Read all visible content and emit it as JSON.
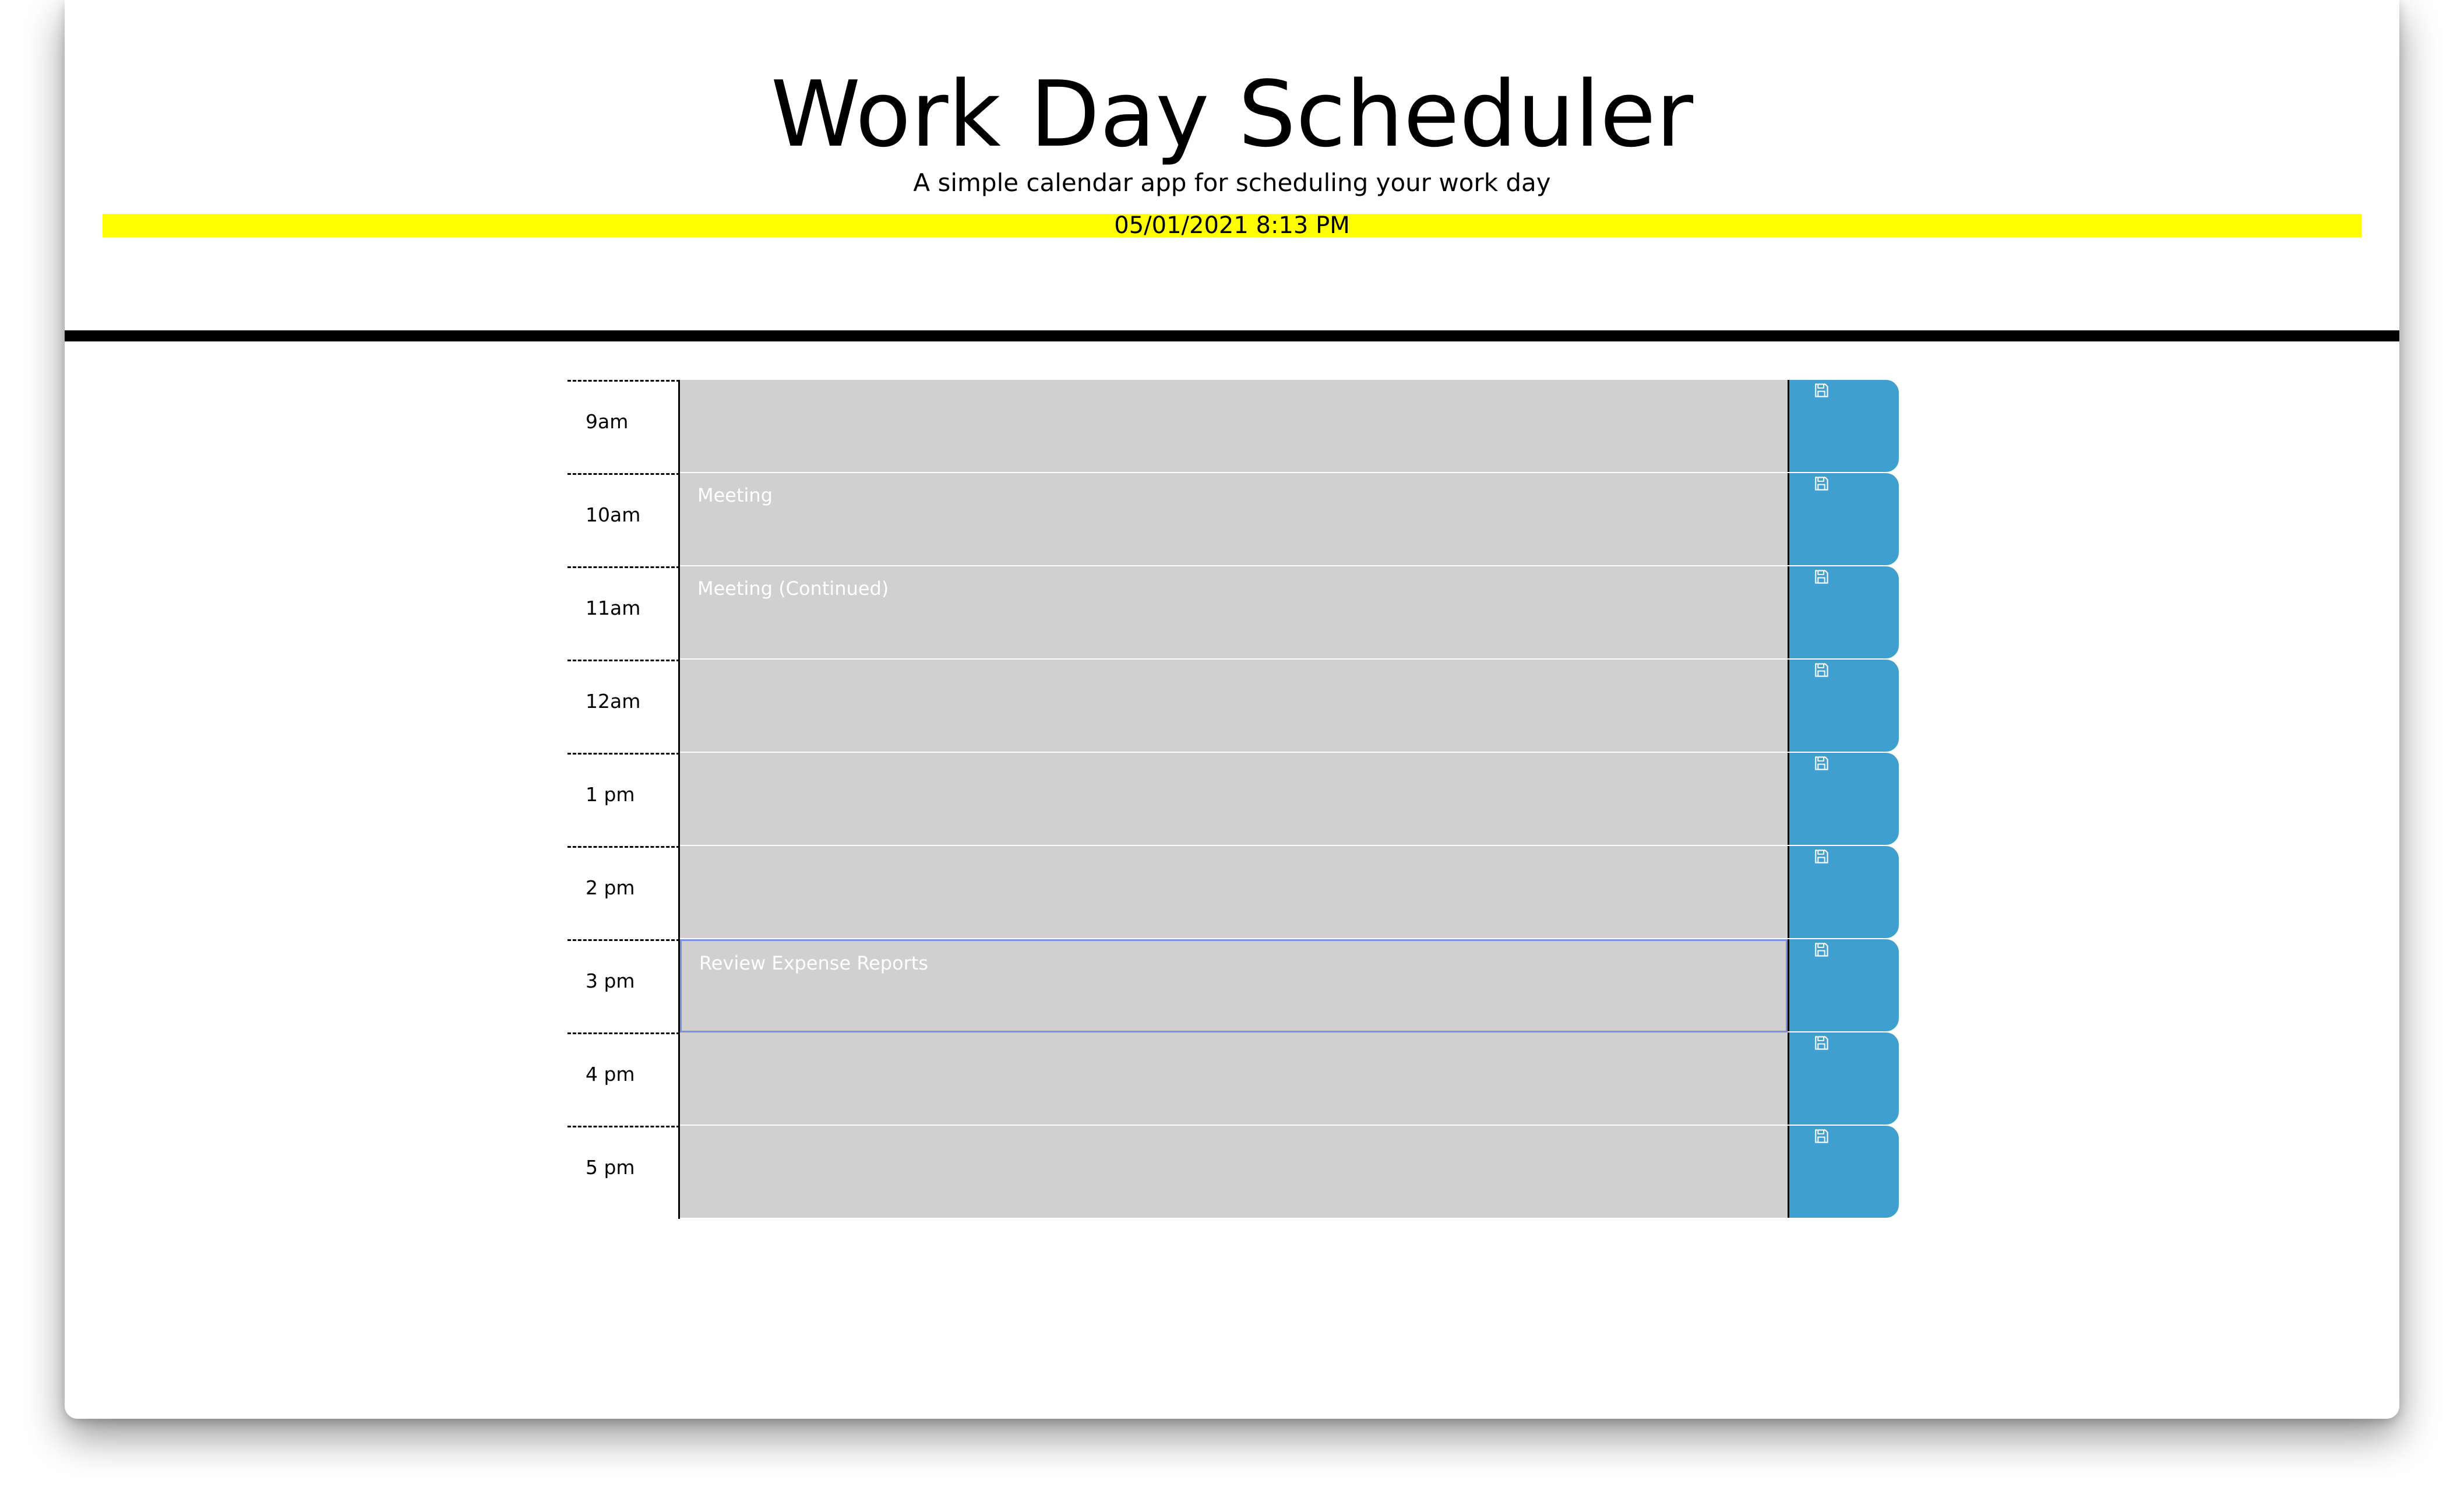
{
  "header": {
    "title": "Work Day Scheduler",
    "subtitle": "A simple calendar app for scheduling your work day",
    "current_datetime": "05/01/2021 8:13 PM"
  },
  "colors": {
    "current_day_highlight": "#ffff00",
    "time_block_past": "#d0d0d0",
    "save_button": "#3fa0cf",
    "header_divider": "#000000"
  },
  "icons": {
    "save": "floppy-disk-icon"
  },
  "time_blocks": [
    {
      "hour": "9am",
      "description": ""
    },
    {
      "hour": "10am",
      "description": "Meeting"
    },
    {
      "hour": "11am",
      "description": "Meeting (Continued)"
    },
    {
      "hour": "12am",
      "description": ""
    },
    {
      "hour": "1 pm",
      "description": ""
    },
    {
      "hour": "2 pm",
      "description": ""
    },
    {
      "hour": "3 pm",
      "description": "Review Expense Reports"
    },
    {
      "hour": "4 pm",
      "description": ""
    },
    {
      "hour": "5 pm",
      "description": ""
    }
  ]
}
